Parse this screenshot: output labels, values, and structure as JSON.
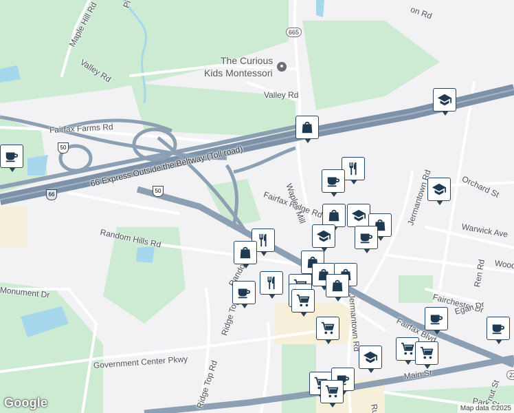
{
  "map": {
    "colors": {
      "park": "#cdebd3",
      "water": "#a6d7ec",
      "highway": "#8c9fb3",
      "road": "#ffffff",
      "land": "#f2f2f4",
      "urban": "#f6efd9",
      "poi": "#1f3a50"
    },
    "labels": {
      "maple_hill": "Maple Hill Rd",
      "valley_nw": "Valley Rd",
      "valley_ne": "Valley Rd",
      "school_name_1": "The Curious",
      "school_name_2": "Kids Montessori",
      "fairfax_farms": "Fairfax Farms Rd",
      "express": "66 Express Outside the Beltway (Toll road)",
      "fairfax_ridge": "Fairfax Ridge Rd",
      "waples_mill": "Waples Mill",
      "random_hills": "Random Hills Rd",
      "random_hills_2": "Random Hills Rd",
      "monument": "Monument Dr",
      "government_center": "Government Center Pkwy",
      "ridge_top": "Ridge Top Rd",
      "ridge_top_2": "Ridge Top Rd",
      "jermantown_n": "Jermantown Rd",
      "jermantown_s": "Jermantown Rd",
      "orchard": "Orchard St",
      "warwick": "Warwick Ave",
      "woodr": "Wood",
      "fairchester": "Fairchester Dr",
      "egan": "Egan Dr",
      "ren": "Ren Rd",
      "fairfax_blvd": "Fairfax Blvd",
      "main_st": "Main St",
      "park_st": "Park St",
      "rus": "Rus",
      "putnut": "nut St",
      "pine": "Pi",
      "top_road": "on Rd"
    },
    "shields": {
      "r665": "665",
      "us50a": "50",
      "us50b": "50",
      "i66": "66",
      "r236": "23"
    },
    "branding": "Google",
    "attribution": "Map data ©2025"
  },
  "pois": [
    {
      "icon": "coffee-icon"
    },
    {
      "icon": "school-icon"
    },
    {
      "icon": "shopping-bag-icon"
    },
    {
      "icon": "restaurant-icon"
    },
    {
      "icon": "coffee-icon"
    },
    {
      "icon": "school-icon"
    },
    {
      "icon": "shopping-bag-icon"
    },
    {
      "icon": "school-icon"
    },
    {
      "icon": "shopping-bag-icon"
    },
    {
      "icon": "coffee-icon"
    },
    {
      "icon": "school-icon"
    },
    {
      "icon": "restaurant-icon"
    },
    {
      "icon": "shopping-bag-icon"
    },
    {
      "icon": "shopping-bag-icon"
    },
    {
      "icon": "shopping-bag-icon"
    },
    {
      "icon": "restaurant-icon"
    },
    {
      "icon": "shopping-bag-icon"
    },
    {
      "icon": "coffee-icon"
    },
    {
      "icon": "shopping-cart-icon"
    },
    {
      "icon": "shopping-bag-icon"
    },
    {
      "icon": "shopping-cart-icon"
    },
    {
      "icon": "coffee-icon"
    },
    {
      "icon": "shopping-cart-icon"
    },
    {
      "icon": "school-icon"
    },
    {
      "icon": "shopping-cart-icon"
    },
    {
      "icon": "shopping-cart-icon"
    },
    {
      "icon": "coffee-icon"
    },
    {
      "icon": "shopping-cart-icon"
    },
    {
      "icon": "shopping-cart-icon"
    },
    {
      "icon": "coffee-icon"
    },
    {
      "icon": "shopping-cart-icon"
    }
  ]
}
